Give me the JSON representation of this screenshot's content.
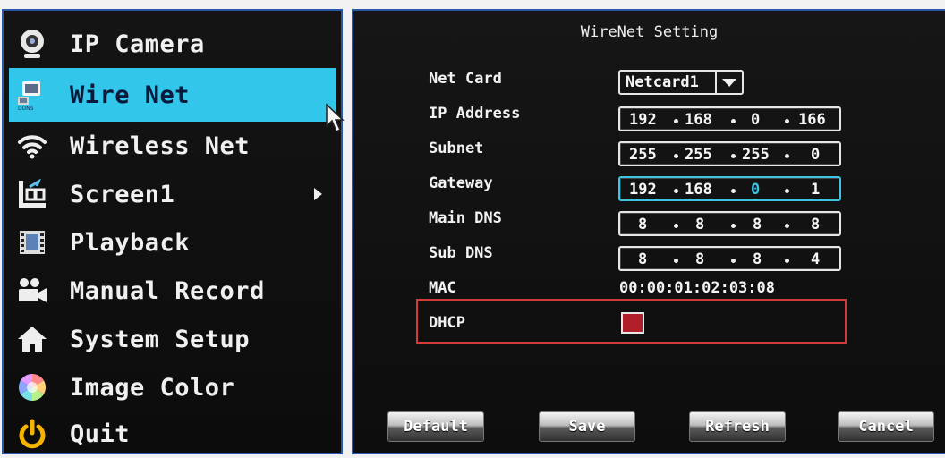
{
  "menu": {
    "items": [
      {
        "label": "IP Camera",
        "icon": "webcam-icon"
      },
      {
        "label": "Wire Net",
        "icon": "wired-network-icon",
        "selected": true
      },
      {
        "label": "Wireless Net",
        "icon": "wifi-icon"
      },
      {
        "label": "Screen1",
        "icon": "screen-layout-icon",
        "has_submenu": true
      },
      {
        "label": "Playback",
        "icon": "film-icon"
      },
      {
        "label": "Manual Record",
        "icon": "camcorder-icon"
      },
      {
        "label": "System Setup",
        "icon": "home-icon"
      },
      {
        "label": "Image Color",
        "icon": "color-wheel-icon"
      },
      {
        "label": "Quit",
        "icon": "power-icon"
      }
    ]
  },
  "panel": {
    "title": "WireNet Setting",
    "net_card": {
      "label": "Net Card",
      "value": "Netcard1"
    },
    "ip_address": {
      "label": "IP Address",
      "octets": [
        "192",
        "168",
        "0",
        "166"
      ]
    },
    "subnet": {
      "label": "Subnet",
      "octets": [
        "255",
        "255",
        "255",
        "0"
      ]
    },
    "gateway": {
      "label": "Gateway",
      "octets": [
        "192",
        "168",
        "0",
        "1"
      ]
    },
    "main_dns": {
      "label": "Main DNS",
      "octets": [
        "8",
        "8",
        "8",
        "8"
      ]
    },
    "sub_dns": {
      "label": "Sub DNS",
      "octets": [
        "8",
        "8",
        "8",
        "4"
      ]
    },
    "mac": {
      "label": "MAC",
      "value": "00:00:01:02:03:08"
    },
    "dhcp": {
      "label": "DHCP",
      "checked": true
    },
    "buttons": {
      "default": "Default",
      "save": "Save",
      "refresh": "Refresh",
      "cancel": "Cancel"
    }
  },
  "colors": {
    "selected_bg": "#31c6ea",
    "focus_border": "#3ec3e3",
    "highlight_box": "#d33a3a",
    "checkbox_fill": "#b1202a",
    "frame_border": "#2a58a8"
  }
}
